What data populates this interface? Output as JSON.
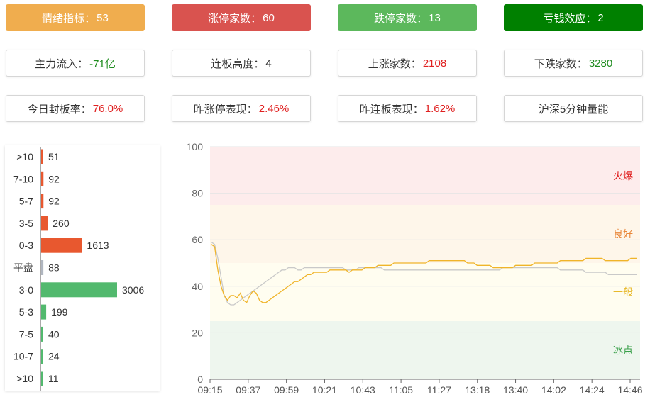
{
  "cards": [
    {
      "label": "情绪指标：",
      "value": "53",
      "bg": "#f0ad4e",
      "style": "filled",
      "valueColor": ""
    },
    {
      "label": "涨停家数：",
      "value": "60",
      "bg": "#d9534f",
      "style": "filled",
      "valueColor": ""
    },
    {
      "label": "跌停家数：",
      "value": "13",
      "bg": "#5cb85c",
      "style": "filled",
      "valueColor": ""
    },
    {
      "label": "亏钱效应：",
      "value": "2",
      "bg": "#008000",
      "style": "filled",
      "valueColor": ""
    },
    {
      "label": "主力流入：",
      "value": "-71亿",
      "style": "outline",
      "valueColor": "green"
    },
    {
      "label": "连板高度：",
      "value": "4",
      "style": "outline",
      "valueColor": ""
    },
    {
      "label": "上涨家数：",
      "value": "2108",
      "style": "outline",
      "valueColor": "red"
    },
    {
      "label": "下跌家数：",
      "value": "3280",
      "style": "outline",
      "valueColor": "green"
    },
    {
      "label": "今日封板率：",
      "value": "76.0%",
      "style": "outline",
      "valueColor": "red"
    },
    {
      "label": "昨涨停表现：",
      "value": "2.46%",
      "style": "outline",
      "valueColor": "red"
    },
    {
      "label": "昨连板表现：",
      "value": "1.62%",
      "style": "outline",
      "valueColor": "red"
    },
    {
      "label": "沪深5分钟量能",
      "value": "",
      "style": "outline",
      "valueColor": ""
    }
  ],
  "chart_data": [
    {
      "type": "bar",
      "orientation": "horizontal",
      "categories": [
        ">10",
        "7-10",
        "5-7",
        "3-5",
        "0-3",
        "平盘",
        "3-0",
        "5-3",
        "7-5",
        "10-7",
        ">10"
      ],
      "values": [
        51,
        92,
        92,
        260,
        1613,
        88,
        3006,
        199,
        40,
        24,
        11
      ],
      "colors": {
        "up": "#e8582f",
        "flat": "#b0b6c0",
        "down": "#52b96e"
      },
      "groups": [
        "up",
        "up",
        "up",
        "up",
        "up",
        "flat",
        "down",
        "down",
        "down",
        "down",
        "down"
      ]
    },
    {
      "type": "line",
      "x_ticks": [
        "09:15",
        "09:37",
        "09:59",
        "10:21",
        "10:43",
        "11:05",
        "11:27",
        "13:18",
        "13:40",
        "14:02",
        "14:24",
        "14:46"
      ],
      "ylim": [
        0,
        100
      ],
      "y_ticks": [
        0,
        20,
        40,
        60,
        80,
        100
      ],
      "zones": [
        {
          "name": "火爆",
          "from": 75,
          "to": 100,
          "fill": "#fdecec",
          "textColor": "#e02020"
        },
        {
          "name": "良好",
          "from": 50,
          "to": 75,
          "fill": "#fef6ea",
          "textColor": "#e8873a"
        },
        {
          "name": "一般",
          "from": 25,
          "to": 50,
          "fill": "#fffdf0",
          "textColor": "#e8b92a"
        },
        {
          "name": "冰点",
          "from": 0,
          "to": 25,
          "fill": "#eef6ee",
          "textColor": "#3aa04a"
        }
      ],
      "series": [
        {
          "color": "#f0b429",
          "values": [
            58,
            57,
            47,
            40,
            36,
            34,
            36,
            36,
            35,
            37,
            34,
            33,
            36,
            38,
            37,
            34,
            33,
            33,
            34,
            35,
            36,
            37,
            38,
            39,
            40,
            41,
            42,
            42,
            43,
            44,
            45,
            45,
            46,
            46,
            46,
            46,
            46,
            47,
            47,
            47,
            47,
            47,
            47,
            46,
            47,
            47,
            47,
            47,
            48,
            48,
            48,
            48,
            49,
            49,
            49,
            49,
            49,
            50,
            50,
            50,
            50,
            50,
            50,
            50,
            50,
            50,
            50,
            50,
            51,
            51,
            51,
            51,
            51,
            51,
            51,
            51,
            51,
            51,
            51,
            51,
            50,
            50,
            50,
            49,
            49,
            49,
            49,
            49,
            48,
            48,
            48,
            48,
            48,
            48,
            48,
            49,
            49,
            49,
            49,
            49,
            49,
            50,
            50,
            50,
            50,
            50,
            50,
            50,
            50,
            51,
            51,
            51,
            51,
            51,
            51,
            51,
            51,
            52,
            52,
            52,
            52,
            52,
            52,
            51,
            51,
            51,
            51,
            51,
            51,
            51,
            51,
            52,
            52,
            52
          ]
        },
        {
          "color": "#c9c9c9",
          "values": [
            59,
            58,
            52,
            44,
            36,
            33,
            32,
            32,
            33,
            34,
            35,
            36,
            37,
            38,
            39,
            40,
            41,
            42,
            43,
            44,
            45,
            46,
            47,
            47,
            48,
            48,
            48,
            47,
            47,
            48,
            48,
            48,
            48,
            48,
            48,
            48,
            48,
            48,
            48,
            48,
            48,
            48,
            47,
            47,
            47,
            47,
            48,
            48,
            48,
            48,
            48,
            48,
            48,
            48,
            47,
            47,
            47,
            47,
            47,
            47,
            47,
            47,
            47,
            47,
            47,
            47,
            47,
            47,
            47,
            47,
            47,
            47,
            47,
            47,
            47,
            47,
            47,
            47,
            47,
            47,
            47,
            47,
            47,
            47,
            47,
            47,
            47,
            47,
            47,
            47,
            47,
            48,
            48,
            48,
            48,
            48,
            48,
            48,
            48,
            48,
            48,
            48,
            48,
            48,
            48,
            48,
            48,
            48,
            48,
            47,
            47,
            47,
            47,
            47,
            47,
            47,
            47,
            46,
            46,
            46,
            46,
            46,
            46,
            46,
            45,
            45,
            45,
            45,
            45,
            45,
            45,
            45,
            45,
            45
          ]
        }
      ]
    }
  ]
}
